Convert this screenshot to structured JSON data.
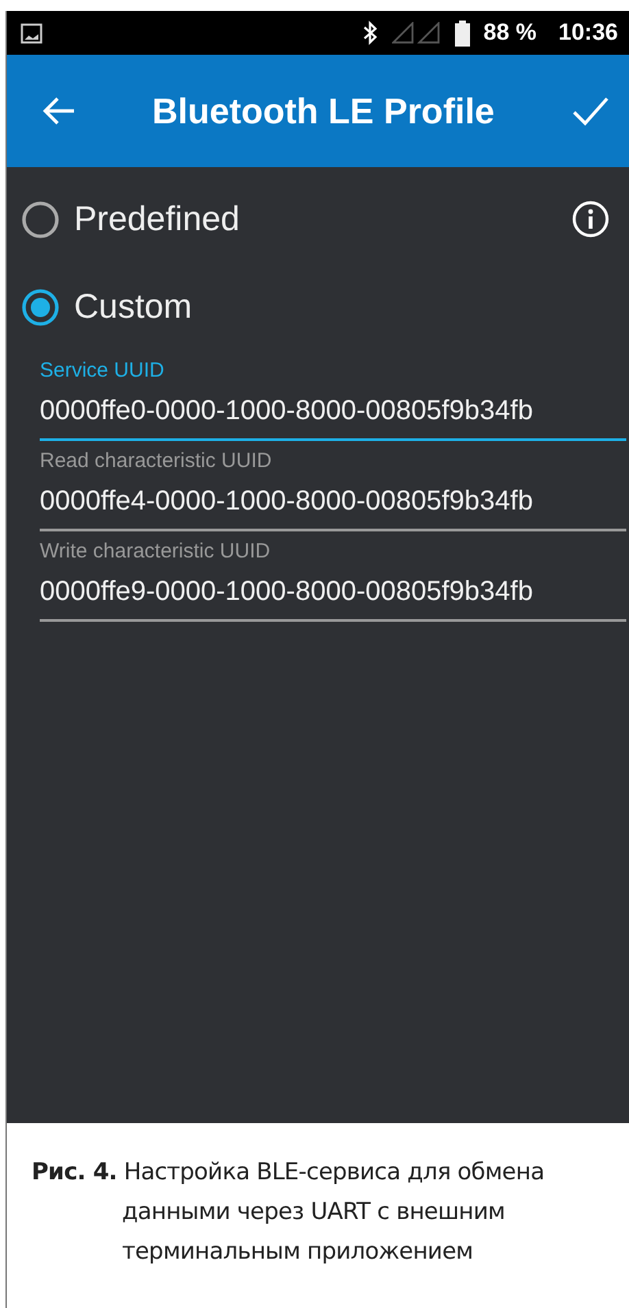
{
  "status_bar": {
    "battery": "88 %",
    "time": "10:36"
  },
  "app_bar": {
    "title": "Bluetooth LE Profile"
  },
  "options": [
    {
      "label": "Predefined",
      "selected": false,
      "info": true
    },
    {
      "label": "Custom",
      "selected": true,
      "info": false
    }
  ],
  "fields": [
    {
      "label": "Service UUID",
      "value": "0000ffe0-0000-1000-8000-00805f9b34fb",
      "focused": true
    },
    {
      "label": "Read characteristic UUID",
      "value": "0000ffe4-0000-1000-8000-00805f9b34fb",
      "focused": false
    },
    {
      "label": "Write characteristic UUID",
      "value": "0000ffe9-0000-1000-8000-00805f9b34fb",
      "focused": false
    }
  ],
  "caption": "**Рис. 4.** Настройка BLE-сервиса для обмена данными через UART с внешним терминальным приложением"
}
